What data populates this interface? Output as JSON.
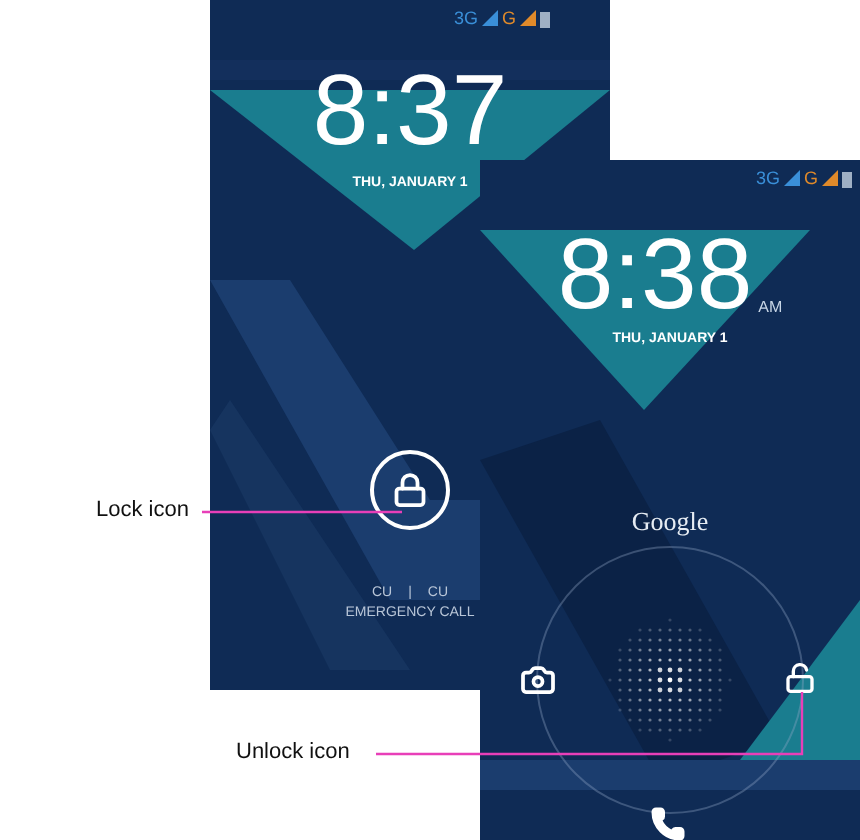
{
  "screens": [
    {
      "kind": "locked",
      "status": {
        "network": "3G",
        "network_2": "G"
      },
      "time": "8:37",
      "date": "THU, JANUARY 1",
      "carriers": [
        "CU",
        "CU"
      ],
      "separator": "|",
      "emergency": "EMERGENCY CALL"
    },
    {
      "kind": "unlock",
      "status": {
        "network": "3G",
        "network_2": "G"
      },
      "time": "8:38",
      "ampm": "AM",
      "date": "THU, JANUARY 1",
      "brand": "Google"
    }
  ],
  "callouts": [
    {
      "label": "Lock icon"
    },
    {
      "label": "Unlock icon"
    }
  ]
}
